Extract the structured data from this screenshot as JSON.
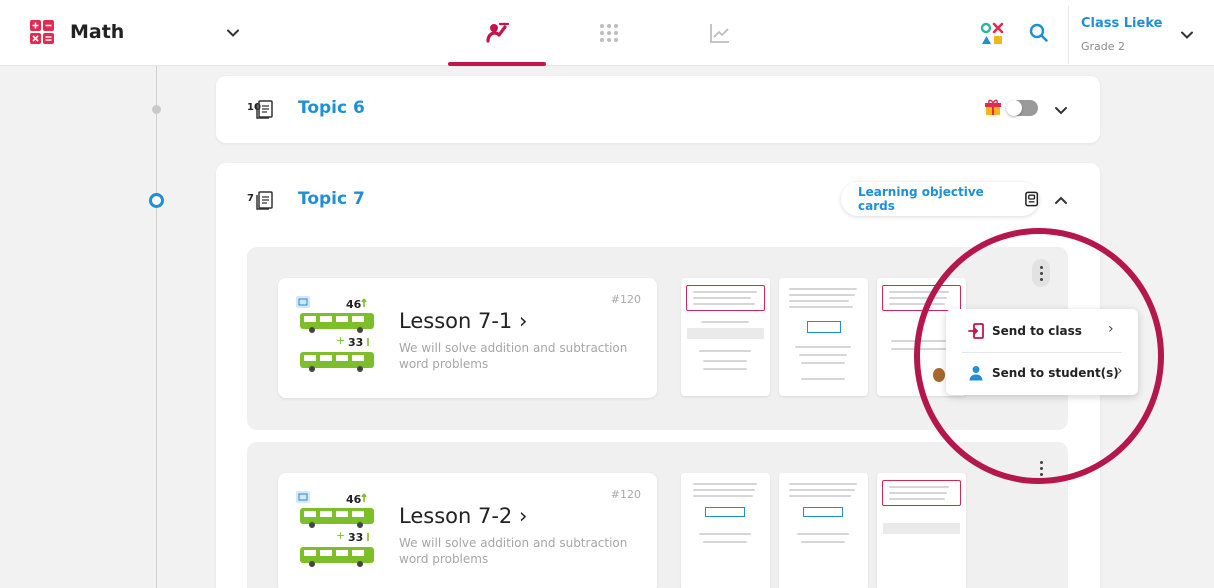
{
  "header": {
    "app_title": "Math",
    "app_icon": "math-operators-icon",
    "nav_tabs": [
      {
        "name": "teach-icon",
        "active": true
      },
      {
        "name": "grid-icon",
        "active": false
      },
      {
        "name": "chart-icon",
        "active": false
      }
    ],
    "tools": [
      "shapes-icon",
      "search-icon"
    ],
    "class_name": "Class Lieke",
    "class_grade": "Grade 2"
  },
  "topics": [
    {
      "count": "10",
      "title": "Topic 6",
      "toggle_on": false,
      "expanded": false
    },
    {
      "count": "7",
      "title": "Topic 7",
      "expanded": true,
      "objective_button": "Learning objective cards"
    }
  ],
  "lessons": [
    {
      "number": "#120",
      "title": "Lesson 7-1 ›",
      "description": "We will solve addition and subtraction word problems",
      "illus_top": "46",
      "illus_bottom": "33"
    },
    {
      "number": "#120",
      "title": "Lesson 7-2 ›",
      "description": "We will solve addition and subtraction word problems",
      "illus_top": "46",
      "illus_bottom": "33"
    }
  ],
  "menu": {
    "items": [
      {
        "label": "Send to class",
        "chevron": "›"
      },
      {
        "label": "Send to student(s)",
        "chevron": "›"
      }
    ]
  },
  "colors": {
    "accent": "#1f8fd6",
    "brand": "#c4144a",
    "highlight": "#b5174c",
    "bus_green": "#7cbf2a"
  }
}
